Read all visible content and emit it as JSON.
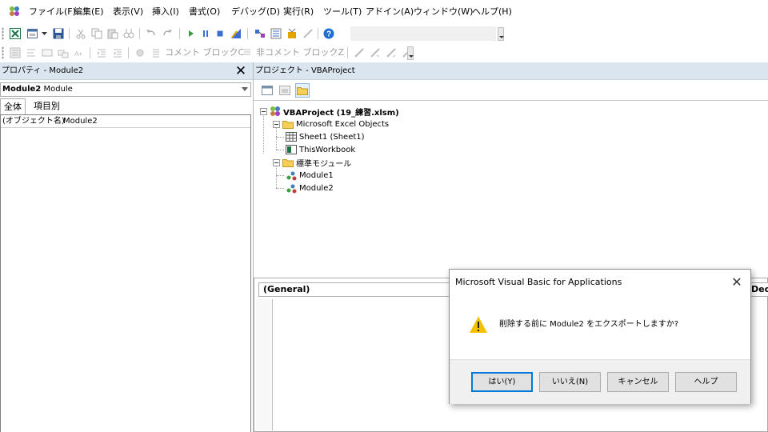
{
  "menubar": {
    "items": [
      "ファイル(F)",
      "編集(E)",
      "表示(V)",
      "挿入(I)",
      "書式(O)",
      "デバッグ(D)",
      "実行(R)",
      "ツール(T)",
      "アドイン(A)",
      "ウィンドウ(W)",
      "ヘルプ(H)"
    ]
  },
  "toolbar2": {
    "comment_block": "コメント ブロックC",
    "uncomment_block": "非コメント ブロックZ"
  },
  "properties": {
    "title": "プロパティ - Module2",
    "close_glyph": "✕",
    "object_name": "Module2",
    "object_type": "Module",
    "tabs": [
      "全体",
      "項目別"
    ],
    "row": {
      "name": "(オブジェクト名)",
      "value": "Module2"
    }
  },
  "project": {
    "title": "プロジェクト - VBAProject",
    "tree": {
      "root": "VBAProject (19_練習.xlsm)",
      "excel_objects": "Microsoft Excel Objects",
      "sheet1": "Sheet1 (Sheet1)",
      "thisworkbook": "ThisWorkbook",
      "modules": "標準モジュール",
      "module1": "Module1",
      "module2": "Module2"
    }
  },
  "code_window": {
    "object_combo": "(General)",
    "proc_combo": "(Declarat"
  },
  "dialog": {
    "title": "Microsoft Visual Basic for Applications",
    "close_glyph": "✕",
    "message": "削除する前に Module2 をエクスポートしますか?",
    "buttons": {
      "yes": "はい(Y)",
      "no": "いいえ(N)",
      "cancel": "キャンセル",
      "help": "ヘルプ"
    }
  },
  "colors": {
    "pane_header_bg": "#dbe5ef",
    "accent_focus": "#0078d7",
    "warning_yellow": "#f5c000"
  }
}
